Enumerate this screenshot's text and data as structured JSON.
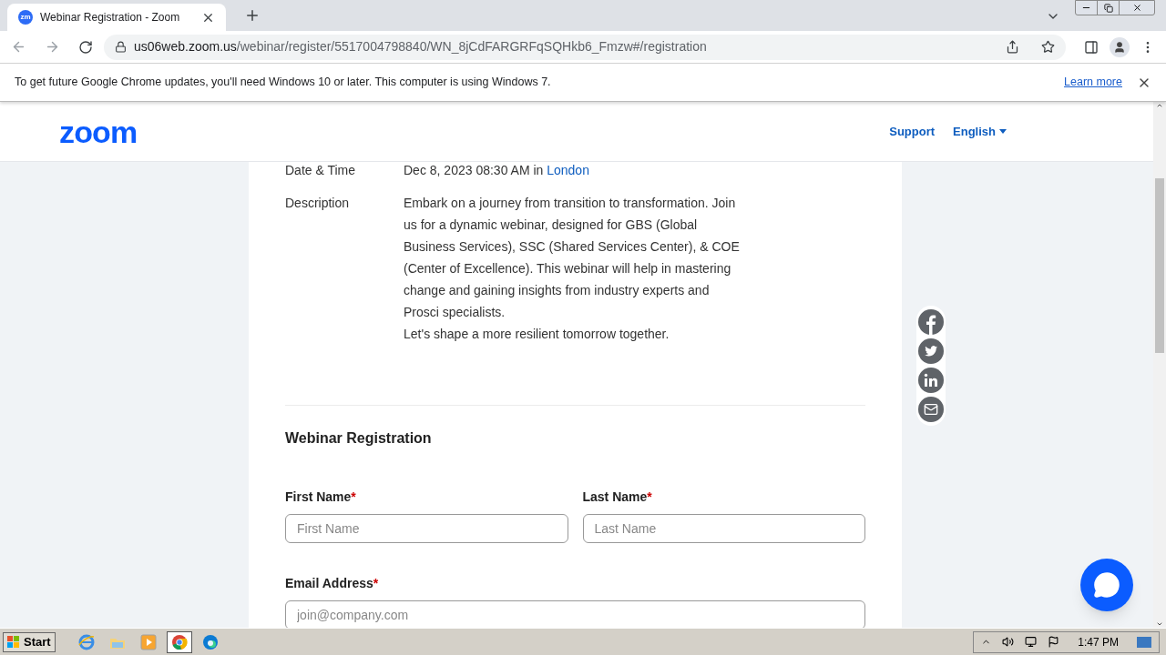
{
  "browser": {
    "tab": {
      "favicon": "zm",
      "title": "Webinar Registration - Zoom",
      "selected": true
    },
    "url": {
      "host": "us06web.zoom.us",
      "path": "/webinar/register/5517004798840/WN_8jCdFARGRFqSQHkb6_Fmzw#/registration"
    },
    "infobar": {
      "message": "To get future Google Chrome updates, you'll need Windows 10 or later. This computer is using Windows 7.",
      "link": "Learn more"
    }
  },
  "header": {
    "logo": "zoom",
    "support": "Support",
    "language": "English"
  },
  "details": [
    {
      "label": "Date & Time",
      "value": "Dec 8, 2023 08:30 AM in",
      "link": "London"
    },
    {
      "label": "Description",
      "paragraphs": [
        "Embark on a journey from transition to transformation. Join us for a dynamic webinar, designed for GBS (Global Business Services), SSC (Shared Services Center), & COE (Center of Excellence). This webinar will help in mastering change and gaining insights from industry experts and Prosci specialists.",
        "Let's shape a more resilient tomorrow together."
      ]
    }
  ],
  "registration": {
    "title": "Webinar Registration",
    "required_mark": "*",
    "rows": [
      [
        {
          "label": "First Name",
          "required": true,
          "placeholder": "First Name"
        },
        {
          "label": "Last Name",
          "required": true,
          "placeholder": "Last Name"
        }
      ],
      [
        {
          "label": "Email Address",
          "required": true,
          "placeholder": "join@company.com"
        }
      ]
    ]
  },
  "share": [
    {
      "kind": "facebook"
    },
    {
      "kind": "twitter"
    },
    {
      "kind": "linkedin"
    },
    {
      "kind": "email"
    }
  ],
  "taskbar": {
    "start": "Start",
    "apps": [
      {
        "kind": "ie",
        "selected": false
      },
      {
        "kind": "folder",
        "selected": false
      },
      {
        "kind": "media",
        "selected": false
      },
      {
        "kind": "chrome",
        "selected": true
      },
      {
        "kind": "edge",
        "selected": false
      }
    ],
    "time": "1:47 PM"
  }
}
